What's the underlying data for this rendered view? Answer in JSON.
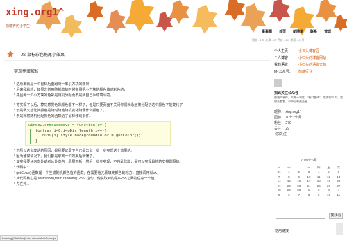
{
  "site": {
    "logo": "xing.org1^",
    "tagline": "前端界的小学生~"
  },
  "nav": [
    "事事刷",
    "首页",
    "新随笔",
    "联系",
    "管理"
  ],
  "metaline": "随笔 - 198  文章 - 10  评论 - 114  阅读 - 11万",
  "post": {
    "title": "JS-鼠标彩色拖尾小效果",
    "head": "实现步骤解析：",
    "lines1": [
      "* 这原本就是一个鼠标后面跟随一串小方块的效果，",
      "* 后来我就想，如果之前用随机数的时候实例把小方块的颜色做成彩色的，",
      "* 并且每一个小方块的色彩是随机分配而不是我自己手动填写的。"
    ],
    "lines2": [
      "* 等实现了以后，算又感觉色彩颜色都不一样了，但是只要页面不关闭你们就永远被分配了这个颜色不能变化了",
      "* 于是我又想让其颜色是随时随地随机变化随便什么颜色了。",
      "* 于是就将随机分配颜色的函数给了鼠标移动事件。"
    ],
    "code": [
      "window.onmousemove = function(ev){",
      "for(var i=0;i<oDiv.length;i++){",
      "oDiv[i].style.backgroundColor = getColor();",
      "}"
    ],
    "lines3": [
      "* 之所以这么废话的原因，是我要记录下自己是怎么一步一步实现这个效果的。",
      "* 因为通常情况下，我们都是拿到一个效果后就愣了，",
      "* 其实我要从内向外或者从外向内一层层剖析，然后一步步实现，不自乱阵脚，是可以实现最终的安排置图的。",
      "* 代码中：",
      "* getColor()函数是一个生成随机颜色值的函数，在需要给元素填充颜色的地方，直接调用就ok；",
      "* 其代码核心是 Math.floor(Math.random()*255) 这句，他获取到的是0-255之间的任意一个值，",
      "* 先在外..."
    ]
  },
  "sidebar": {
    "rows": [
      {
        "label": "个人主页：",
        "value": "小石头博客园"
      },
      {
        "label": "个人博客：",
        "value": "小石头的博客网站"
      },
      {
        "label": "我的语雀：",
        "value": "小石头的语雀文档"
      },
      {
        "label": "My公众号：",
        "value": "前端行业"
      }
    ],
    "follow": "扫码关注公众号",
    "follow_desc": "前端大事件，大神一句话，\"有口皆碑\"，世界那么大，我想去看看，书中自有黄金屋...",
    "stats": [
      "昵称：  xing.org1^",
      "园龄：  10年2个月",
      "粉丝：  279",
      "关注：  29",
      "+加关注"
    ],
    "calendar": {
      "title": "2020年6月",
      "weekdays": [
        "日",
        "一",
        "二",
        "三",
        "四",
        "五",
        "六"
      ],
      "weeks": [
        [
          "31",
          "1",
          "2",
          "3",
          "4",
          "5",
          "6"
        ],
        [
          "7",
          "8",
          "9",
          "10",
          "11",
          "12",
          "13"
        ],
        [
          "14",
          "15",
          "16",
          "17",
          "18",
          "19",
          "20"
        ],
        [
          "21",
          "22",
          "23",
          "24",
          "25",
          "26",
          "27"
        ],
        [
          "28",
          "29",
          "30",
          "1",
          "2",
          "3",
          "4"
        ],
        [
          "5",
          "6",
          "7",
          "8",
          "9",
          "10",
          "11"
        ]
      ]
    },
    "search_placeholder": "",
    "search_button": "找找看",
    "foot": "常用链接"
  },
  "status": "Loading [MathJax]/extensions/MathZoom.js"
}
